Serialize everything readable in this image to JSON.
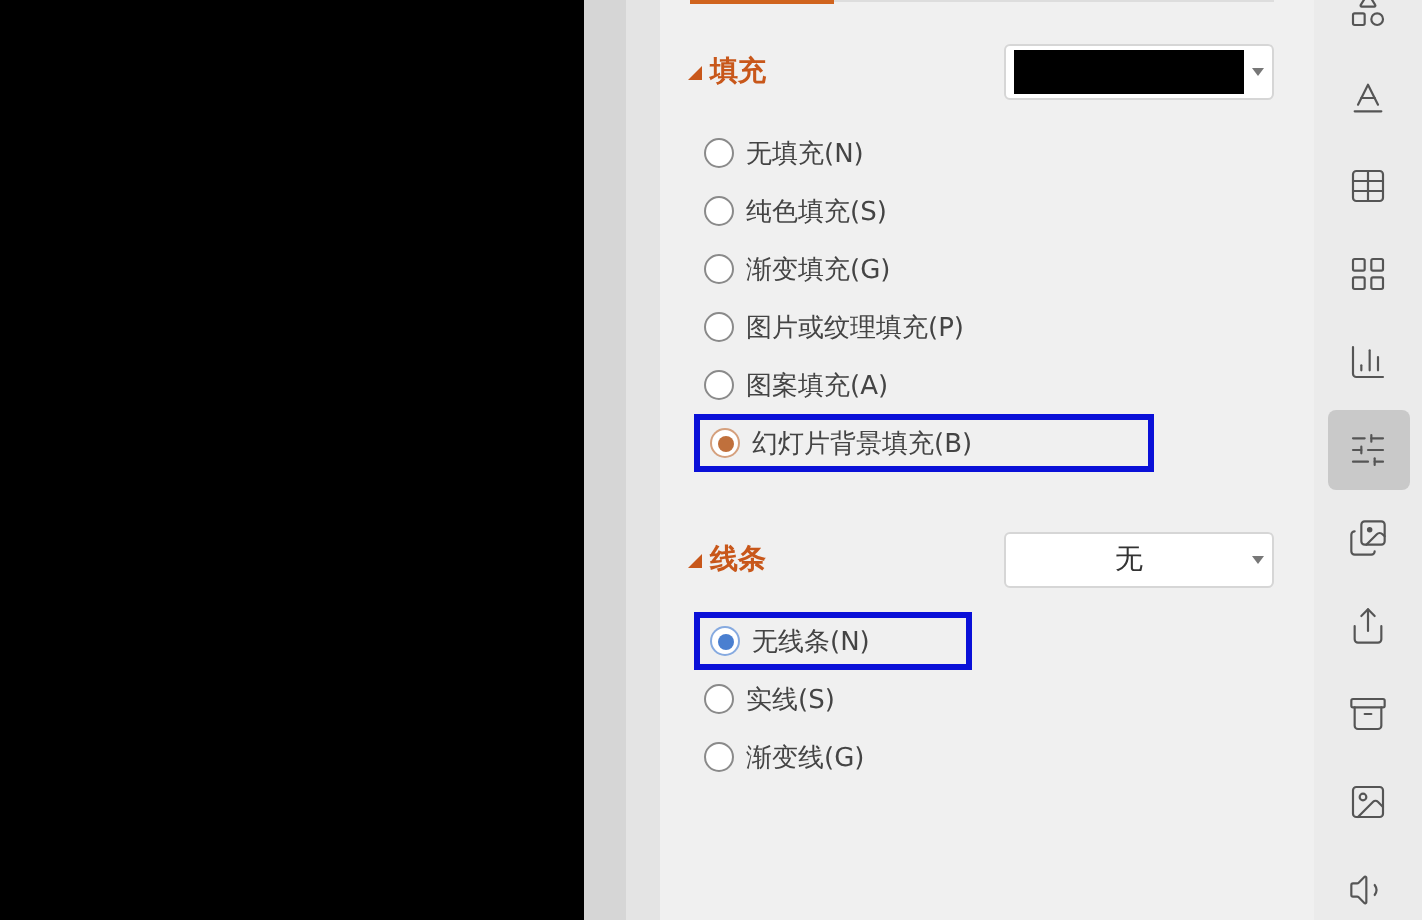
{
  "sections": [
    {
      "kind": "fill",
      "title": "填充",
      "expanded": true,
      "dropdown": {
        "kind": "swatch",
        "color": "#000000"
      },
      "options": [
        {
          "label": "无填充(N)",
          "selected": false,
          "highlighted": false
        },
        {
          "label": "纯色填充(S)",
          "selected": false,
          "highlighted": false
        },
        {
          "label": "渐变填充(G)",
          "selected": false,
          "highlighted": false
        },
        {
          "label": "图片或纹理填充(P)",
          "selected": false,
          "highlighted": false
        },
        {
          "label": "图案填充(A)",
          "selected": false,
          "highlighted": false
        },
        {
          "label": "幻灯片背景填充(B)",
          "selected": true,
          "highlighted": true
        }
      ]
    },
    {
      "kind": "line",
      "title": "线条",
      "expanded": true,
      "dropdown": {
        "kind": "text",
        "value": "无"
      },
      "options": [
        {
          "label": "无线条(N)",
          "selected": true,
          "highlighted": true
        },
        {
          "label": "实线(S)",
          "selected": false,
          "highlighted": false
        },
        {
          "label": "渐变线(G)",
          "selected": false,
          "highlighted": false
        }
      ]
    }
  ],
  "sidebar": [
    {
      "selected": false
    },
    {
      "selected": false
    },
    {
      "selected": false
    },
    {
      "selected": false
    },
    {
      "selected": false
    },
    {
      "selected": true
    },
    {
      "selected": false
    },
    {
      "selected": false
    },
    {
      "selected": false
    },
    {
      "selected": false
    },
    {
      "selected": false
    }
  ]
}
